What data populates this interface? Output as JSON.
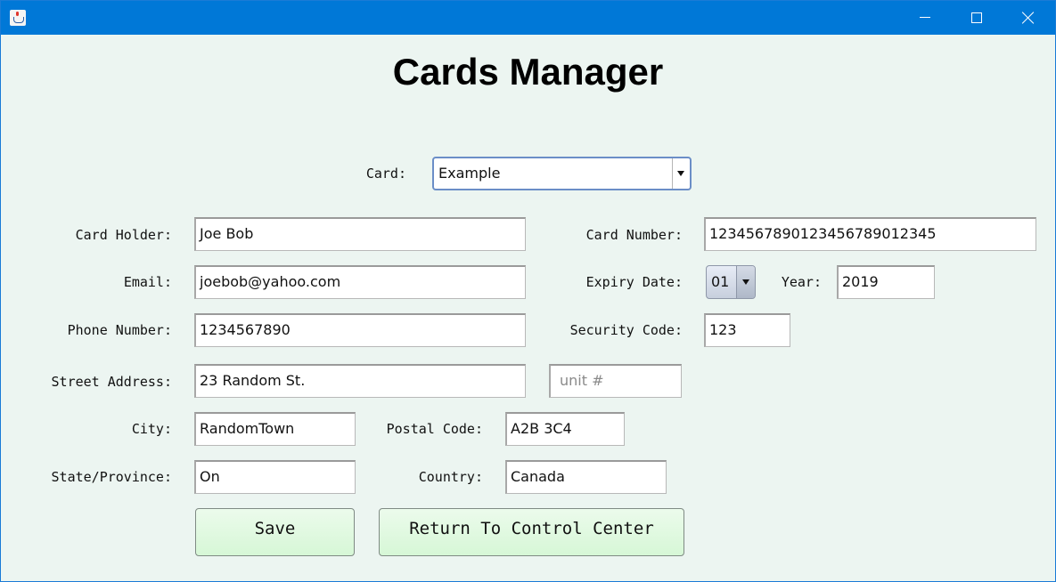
{
  "window": {
    "controls": {
      "minimize": "minimize-icon",
      "maximize": "maximize-icon",
      "close": "close-icon"
    }
  },
  "page_title": "Cards Manager",
  "card_selector": {
    "label": "Card:",
    "value": "Example"
  },
  "labels": {
    "card_holder": "Card Holder:",
    "card_number": "Card Number:",
    "email": "Email:",
    "expiry_date": "Expiry Date:",
    "year": "Year:",
    "phone_number": "Phone Number:",
    "security_code": "Security Code:",
    "street_address": "Street Address:",
    "city": "City:",
    "postal_code": "Postal Code:",
    "state_province": "State/Province:",
    "country": "Country:"
  },
  "values": {
    "card_holder": "Joe Bob",
    "card_number": "1234567890123456789012345",
    "email": "joebob@yahoo.com",
    "expiry_month": "01",
    "year": "2019",
    "phone_number": "1234567890",
    "security_code": "123",
    "street_address": "23 Random St.",
    "city": "RandomTown",
    "postal_code": "A2B 3C4",
    "state_province": "On",
    "country": "Canada"
  },
  "placeholders": {
    "unit": "unit #"
  },
  "buttons": {
    "save": "Save",
    "return": "Return To Control Center"
  }
}
